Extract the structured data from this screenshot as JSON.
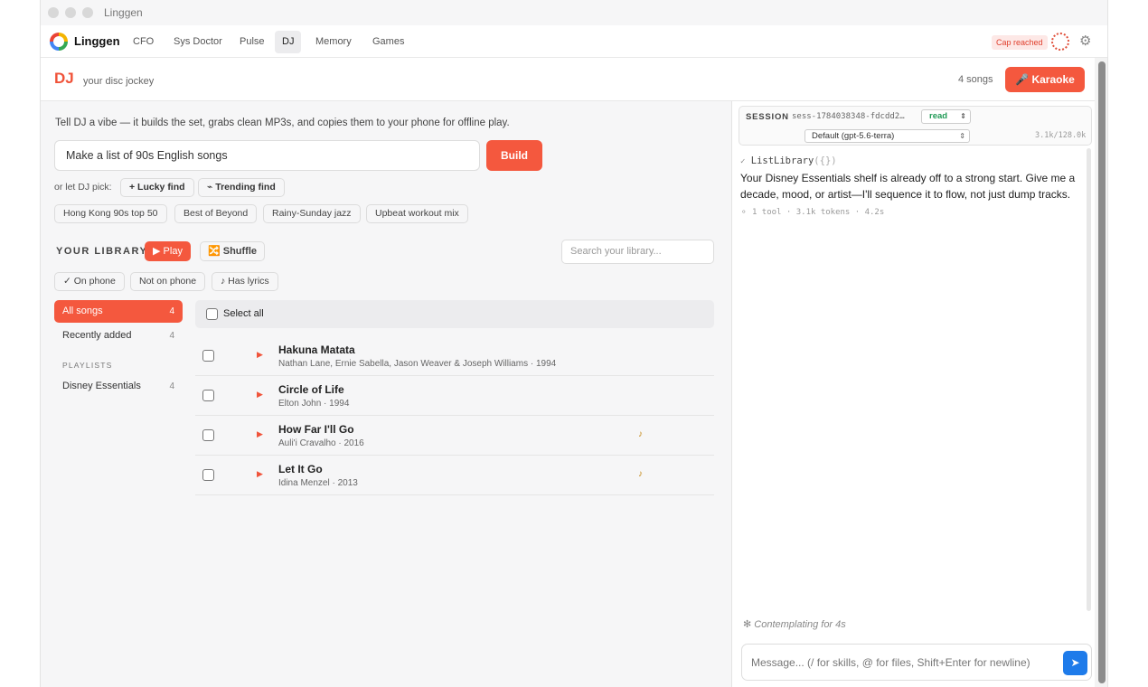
{
  "window": {
    "title": "Linggen"
  },
  "nav": {
    "brand": "Linggen",
    "tabs": [
      {
        "label": "CFO"
      },
      {
        "label": "Sys Doctor"
      },
      {
        "label": "Pulse"
      },
      {
        "label": "DJ",
        "active": true
      },
      {
        "label": "Memory"
      },
      {
        "label": "Games"
      }
    ],
    "cap_badge": "Cap reached",
    "settings_icon": "gear-icon"
  },
  "header": {
    "title": "DJ",
    "subtitle": "your disc jockey",
    "song_count": "4 songs",
    "karaoke_label": "🎤 Karaoke"
  },
  "builder": {
    "intro": "Tell DJ a vibe — it builds the set, grabs clean MP3s, and copies them to your phone for offline play.",
    "vibe_value": "Make a list of 90s English songs",
    "build_label": "Build",
    "pick_label": "or let DJ pick:",
    "pick_chips": [
      "+ Lucky find",
      "⌁ Trending find"
    ],
    "suggestions": [
      "Hong Kong 90s top 50",
      "Best of Beyond",
      "Rainy-Sunday jazz",
      "Upbeat workout mix"
    ]
  },
  "library": {
    "label": "YOUR LIBRARY",
    "play_label": "▶ Play",
    "shuffle_label": "🔀 Shuffle",
    "search_placeholder": "Search your library...",
    "filters": [
      "✓ On phone",
      "Not on phone",
      "♪ Has lyrics"
    ],
    "sidebar": {
      "items": [
        {
          "label": "All songs",
          "count": "4"
        },
        {
          "label": "Recently added",
          "count": "4"
        }
      ],
      "playlists_label": "PLAYLISTS",
      "playlists": [
        {
          "label": "Disney Essentials",
          "count": "4"
        }
      ]
    },
    "select_all": "Select all",
    "songs": [
      {
        "title": "Hakuna Matata",
        "meta": "Nathan Lane, Ernie Sabella, Jason Weaver & Joseph Williams · 1994",
        "lyrics": ""
      },
      {
        "title": "Circle of Life",
        "meta": "Elton John · 1994",
        "lyrics": ""
      },
      {
        "title": "How Far I'll Go",
        "meta": "Auli'i Cravalho · 2016",
        "lyrics": "♪"
      },
      {
        "title": "Let It Go",
        "meta": "Idina Menzel · 2013",
        "lyrics": "♪"
      }
    ]
  },
  "chat": {
    "session_label": "SESSION",
    "session_id": "sess-1784038348-fdcdd2…",
    "mode": "read",
    "model": "Default (gpt-5.6-terra)",
    "tokens": "3.1k/128.0k",
    "tool_name": "ListLibrary",
    "tool_args": "({})",
    "reply": "Your Disney Essentials shelf is already off to a strong start. Give me a decade, mood, or artist—I'll sequence it to flow, not just dump tracks.",
    "stats": "⚬ 1 tool · 3.1k tokens · 4.2s",
    "thinking": "✻ Contemplating for 4s",
    "composer_placeholder": "Message... (/ for skills, @ for files, Shift+Enter for newline)"
  },
  "colors": {
    "accent": "#f4583e",
    "send": "#1e7bea",
    "read_mode": "#1f9a55"
  }
}
